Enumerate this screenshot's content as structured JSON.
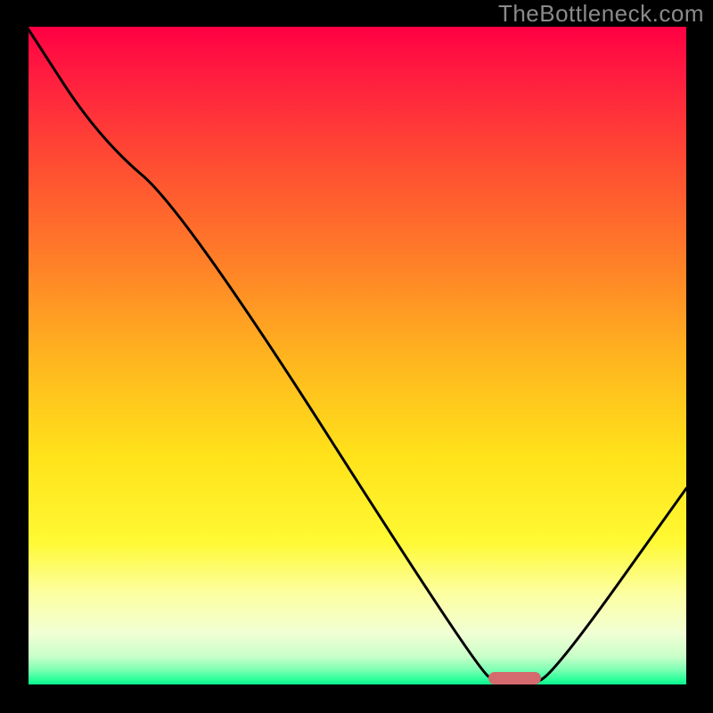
{
  "watermark": "TheBottleneck.com",
  "chart_data": {
    "type": "line",
    "title": "",
    "xlabel": "",
    "ylabel": "",
    "xlim": [
      0,
      100
    ],
    "ylim": [
      0,
      100
    ],
    "x": [
      0,
      11,
      24,
      68,
      72,
      76,
      80,
      100
    ],
    "values": [
      100,
      83,
      72,
      3,
      0,
      0,
      2,
      30
    ],
    "gradient_stops": [
      {
        "pos": 0.0,
        "color": "#ff0043"
      },
      {
        "pos": 0.08,
        "color": "#ff1f3f"
      },
      {
        "pos": 0.2,
        "color": "#ff4a33"
      },
      {
        "pos": 0.35,
        "color": "#ff7d28"
      },
      {
        "pos": 0.5,
        "color": "#ffb41f"
      },
      {
        "pos": 0.65,
        "color": "#ffe21a"
      },
      {
        "pos": 0.78,
        "color": "#fff933"
      },
      {
        "pos": 0.86,
        "color": "#fcffa2"
      },
      {
        "pos": 0.92,
        "color": "#f1ffd4"
      },
      {
        "pos": 0.955,
        "color": "#c8ffc8"
      },
      {
        "pos": 0.975,
        "color": "#7dffb3"
      },
      {
        "pos": 0.99,
        "color": "#29ff9a"
      },
      {
        "pos": 1.0,
        "color": "#00e887"
      }
    ],
    "marker": {
      "x_center": 74,
      "width": 8,
      "color": "#d46a6e"
    },
    "axis_color": "#000000",
    "axis_width": 4,
    "curve_color": "#000000",
    "curve_width": 3
  }
}
